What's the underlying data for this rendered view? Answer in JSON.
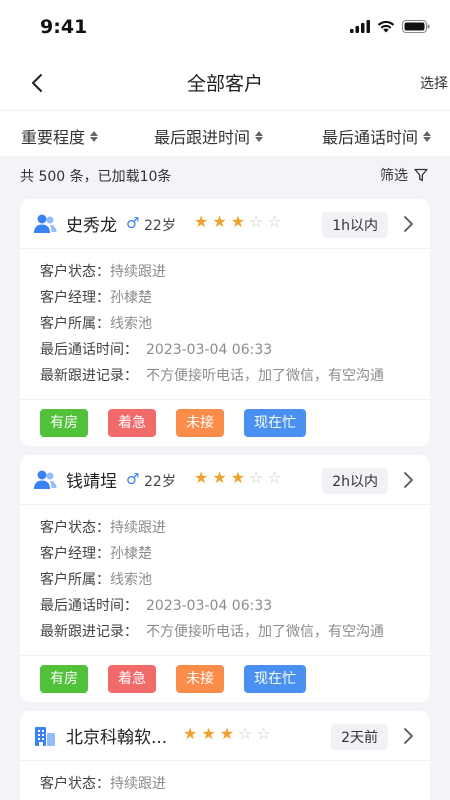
{
  "status_bar": {
    "time": "9:41"
  },
  "nav": {
    "title": "全部客户",
    "right_action": "选择"
  },
  "sort": [
    "重要程度",
    "最后跟进时间",
    "最后通话时间"
  ],
  "summary": {
    "text": "共 500 条，已加载10条",
    "filter_label": "筛选"
  },
  "field_labels": {
    "status": "客户状态：",
    "manager": "客户经理：",
    "belongs": "客户所属：",
    "last_call": "最后通话时间：",
    "last_follow": "最新跟进记录："
  },
  "colors": {
    "accent": "#3b82f6",
    "star": "#f0a12a"
  },
  "customers": [
    {
      "icon": "person-group-icon",
      "name": "史秀龙",
      "gender": "♂",
      "age": "22岁",
      "rating": 3,
      "max_rating": 5,
      "time_badge": "1h以内",
      "status": "持续跟进",
      "manager": "孙棣楚",
      "belongs": "线索池",
      "last_call": "2023-03-04 06:33",
      "last_follow": "不方便接听电话，加了微信，有空沟通",
      "tags": [
        {
          "label": "有房",
          "color": "#52c23b"
        },
        {
          "label": "着急",
          "color": "#f26b6b"
        },
        {
          "label": "未接",
          "color": "#fb8c4a"
        },
        {
          "label": "现在忙",
          "color": "#4a90f0"
        }
      ]
    },
    {
      "icon": "person-group-icon",
      "name": "钱靖埕",
      "gender": "♂",
      "age": "22岁",
      "rating": 3,
      "max_rating": 5,
      "time_badge": "2h以内",
      "status": "持续跟进",
      "manager": "孙棣楚",
      "belongs": "线索池",
      "last_call": "2023-03-04 06:33",
      "last_follow": "不方便接听电话，加了微信，有空沟通",
      "tags": [
        {
          "label": "有房",
          "color": "#52c23b"
        },
        {
          "label": "着急",
          "color": "#f26b6b"
        },
        {
          "label": "未接",
          "color": "#fb8c4a"
        },
        {
          "label": "现在忙",
          "color": "#4a90f0"
        }
      ]
    },
    {
      "icon": "building-icon",
      "name": "北京科翰软...",
      "rating": 3,
      "max_rating": 5,
      "time_badge": "2天前",
      "status": "持续跟进"
    }
  ]
}
